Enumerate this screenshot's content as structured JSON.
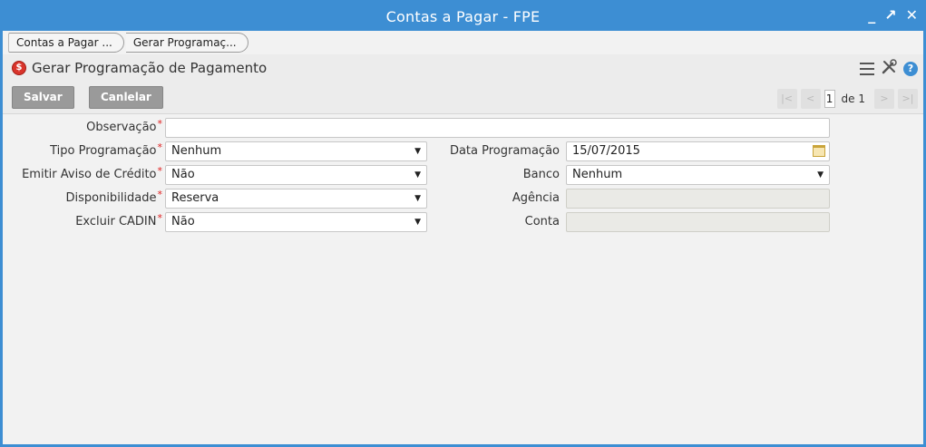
{
  "window": {
    "title": "Contas a Pagar - FPE",
    "minimize": "_",
    "maximize": "↗",
    "close": "✕"
  },
  "breadcrumbs": [
    "Contas a Pagar ...",
    "Gerar Programaç..."
  ],
  "header": {
    "icon_glyph": "$",
    "title": "Gerar Programação de Pagamento",
    "help_glyph": "?"
  },
  "toolbar": {
    "save_label": "Salvar",
    "cancel_label": "Canlelar"
  },
  "pager": {
    "first": "|<",
    "prev": "<",
    "current": "1",
    "of_text": "de 1",
    "next": ">",
    "last": ">|"
  },
  "form": {
    "observacao": {
      "label": "Observação",
      "value": ""
    },
    "tipo_programacao": {
      "label": "Tipo Programação",
      "value": "Nenhum"
    },
    "emitir_aviso": {
      "label": "Emitir Aviso de Crédito",
      "value": "Não"
    },
    "disponibilidade": {
      "label": "Disponibilidade",
      "value": "Reserva"
    },
    "excluir_cadin": {
      "label": "Excluir CADIN",
      "value": "Não"
    },
    "data_programacao": {
      "label": "Data Programação",
      "value": "15/07/2015"
    },
    "banco": {
      "label": "Banco",
      "value": "Nenhum"
    },
    "agencia": {
      "label": "Agência",
      "value": ""
    },
    "conta": {
      "label": "Conta",
      "value": ""
    },
    "required_mark": "*",
    "dropdown_arrow": "▼"
  },
  "colors": {
    "accent": "#3d8ed3",
    "required": "#e02020",
    "button": "#9a9a9a"
  }
}
